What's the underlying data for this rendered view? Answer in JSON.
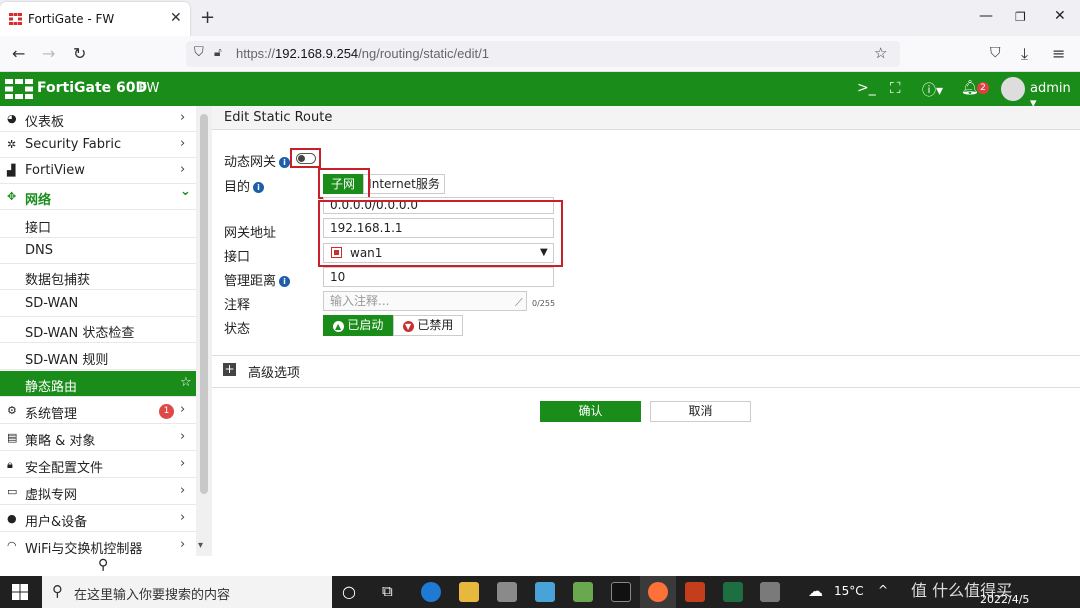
{
  "browser": {
    "tab_title": "FortiGate - FW",
    "url_prefix": "https://",
    "url_host": "192.168.9.254",
    "url_path": "/ng/routing/static/edit/1"
  },
  "header": {
    "model": "FortiGate 60D",
    "hostname": "FW",
    "notif_count": "2",
    "user": "admin",
    "brand_color": "#1a8c1a"
  },
  "sidebar": {
    "items": [
      {
        "label": "仪表板",
        "icon": "dashboard-icon"
      },
      {
        "label": "Security Fabric",
        "icon": "fabric-icon"
      },
      {
        "label": "FortiView",
        "icon": "chart-icon"
      },
      {
        "label": "网络",
        "icon": "network-icon"
      },
      {
        "label": "接口"
      },
      {
        "label": "DNS"
      },
      {
        "label": "数据包捕获"
      },
      {
        "label": "SD-WAN"
      },
      {
        "label": "SD-WAN 状态检查"
      },
      {
        "label": "SD-WAN 规则"
      },
      {
        "label": "静态路由"
      },
      {
        "label": "系统管理",
        "icon": "gear-icon",
        "badge": "1"
      },
      {
        "label": "策略 & 对象",
        "icon": "policy-icon"
      },
      {
        "label": "安全配置文件",
        "icon": "lock-icon"
      },
      {
        "label": "虚拟专网",
        "icon": "laptop-icon"
      },
      {
        "label": "用户&设备",
        "icon": "user-icon"
      },
      {
        "label": "WiFi与交换机控制器",
        "icon": "wifi-icon"
      }
    ]
  },
  "form": {
    "title": "Edit Static Route",
    "dynamic_gw_label": "动态网关",
    "dest_label": "目的",
    "dest_subnet": "子网",
    "dest_inet": "Internet服务",
    "dest_value": "0.0.0.0/0.0.0.0",
    "gw_label": "网关地址",
    "gw_value": "192.168.1.1",
    "iface_label": "接口",
    "iface_value": "wan1",
    "distance_label": "管理距离",
    "distance_value": "10",
    "comment_label": "注释",
    "comment_placeholder": "输入注释...",
    "comment_count": "0/255",
    "status_label": "状态",
    "status_on": "已启动",
    "status_off": "已禁用",
    "advanced": "高级选项",
    "ok": "确认",
    "cancel": "取消"
  },
  "taskbar": {
    "search_placeholder": "在这里输入你要搜索的内容",
    "weather": "15°C",
    "date": "2022/4/5",
    "watermark": "值 什么值得买"
  }
}
